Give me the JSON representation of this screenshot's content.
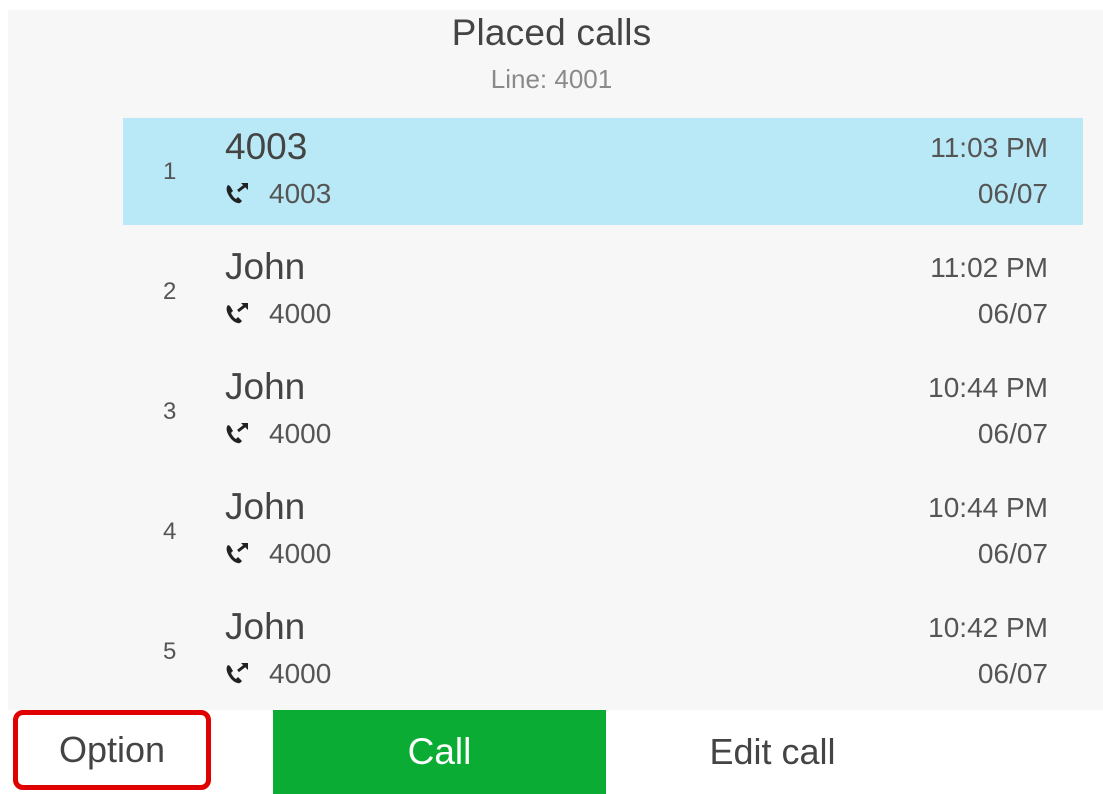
{
  "header": {
    "title": "Placed calls",
    "line": "Line: 4001"
  },
  "calls": [
    {
      "index": "1",
      "name": "4003",
      "number": "4003",
      "time": "11:03 PM",
      "date": "06/07",
      "icon": "outgoing-call-icon",
      "selected": true
    },
    {
      "index": "2",
      "name": "John",
      "number": "4000",
      "time": "11:02 PM",
      "date": "06/07",
      "icon": "outgoing-call-icon",
      "selected": false
    },
    {
      "index": "3",
      "name": "John",
      "number": "4000",
      "time": "10:44 PM",
      "date": "06/07",
      "icon": "outgoing-call-icon",
      "selected": false
    },
    {
      "index": "4",
      "name": "John",
      "number": "4000",
      "time": "10:44 PM",
      "date": "06/07",
      "icon": "outgoing-call-icon",
      "selected": false
    },
    {
      "index": "5",
      "name": "John",
      "number": "4000",
      "time": "10:42 PM",
      "date": "06/07",
      "icon": "outgoing-call-icon",
      "selected": false
    }
  ],
  "softkeys": {
    "option": "Option",
    "call": "Call",
    "edit_call": "Edit call"
  },
  "colors": {
    "selected_row": "#b9e9f6",
    "call_button": "#0bac33",
    "highlight_border": "#e00000"
  }
}
